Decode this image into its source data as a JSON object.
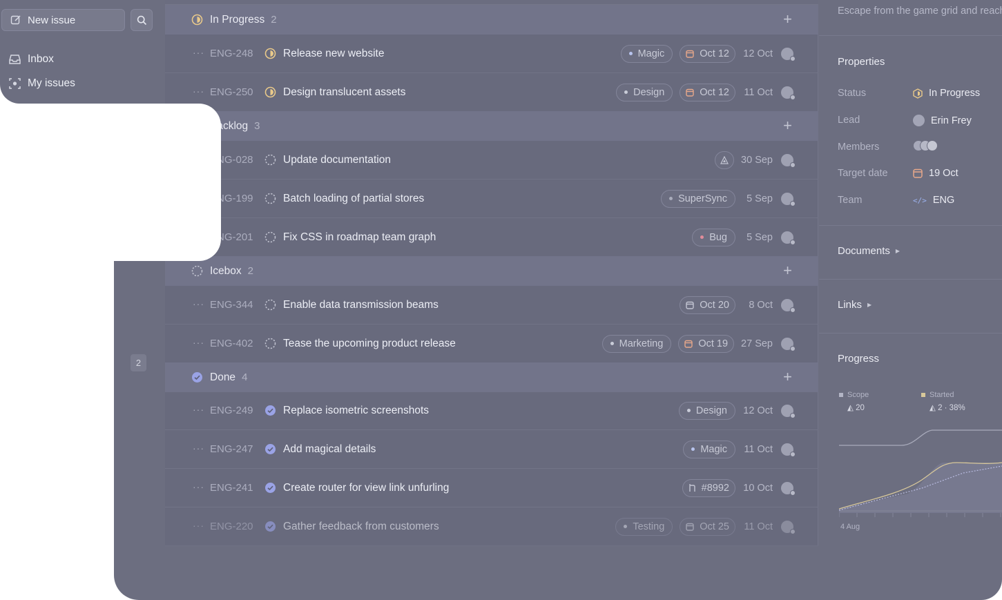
{
  "sidebar": {
    "new_issue_label": "New issue",
    "nav": [
      {
        "label": "Inbox"
      },
      {
        "label": "My issues"
      }
    ],
    "badge": "2"
  },
  "groups": [
    {
      "title": "In Progress",
      "count": "2"
    },
    {
      "title": "Backlog",
      "count": "3"
    },
    {
      "title": "Icebox",
      "count": "2"
    },
    {
      "title": "Done",
      "count": "4"
    }
  ],
  "issues": [
    {
      "id": "ENG-248",
      "title": "Release new website",
      "label": "Magic",
      "label_color": "#b8c4ee",
      "due": "Oct 12",
      "date": "12 Oct"
    },
    {
      "id": "ENG-250",
      "title": "Design translucent assets",
      "label": "Design",
      "label_color": "#c9ccd8",
      "due": "Oct 12",
      "date": "11 Oct"
    },
    {
      "id": "ENG-028",
      "title": "Update documentation",
      "date": "30 Sep"
    },
    {
      "id": "ENG-199",
      "title": "Batch loading of partial stores",
      "label": "SuperSync",
      "label_color": "#a9acbb",
      "date": "5 Sep"
    },
    {
      "id": "ENG-201",
      "title": "Fix CSS in roadmap team graph",
      "label": "Bug",
      "label_color": "#e08c9a",
      "date": "5 Sep"
    },
    {
      "id": "ENG-344",
      "title": "Enable data transmission beams",
      "due": "Oct 20",
      "date": "8 Oct"
    },
    {
      "id": "ENG-402",
      "title": "Tease the upcoming product release",
      "label": "Marketing",
      "label_color": "#c9ccd8",
      "due": "Oct 19",
      "date": "27 Sep"
    },
    {
      "id": "ENG-249",
      "title": "Replace isometric screenshots",
      "label": "Design",
      "label_color": "#c9ccd8",
      "date": "12 Oct"
    },
    {
      "id": "ENG-247",
      "title": "Add magical details",
      "label": "Magic",
      "label_color": "#b8c4ee",
      "date": "11 Oct"
    },
    {
      "id": "ENG-241",
      "title": "Create router for view link unfurling",
      "pr": "#8992",
      "date": "10 Oct"
    },
    {
      "id": "ENG-220",
      "title": "Gather feedback from customers",
      "label": "Testing",
      "label_color": "#c9ccd8",
      "due": "Oct 25",
      "date": "11 Oct"
    }
  ],
  "panel": {
    "description": "Escape from the game grid and reach",
    "properties_title": "Properties",
    "status_label": "Status",
    "status_value": "In Progress",
    "lead_label": "Lead",
    "lead_value": "Erin Frey",
    "members_label": "Members",
    "target_label": "Target date",
    "target_value": "19 Oct",
    "team_label": "Team",
    "team_value": "ENG",
    "documents_title": "Documents",
    "links_title": "Links",
    "progress_title": "Progress",
    "scope_label": "Scope",
    "scope_value": "20",
    "started_label": "Started",
    "started_value": "2 · 38%",
    "axis_start": "4 Aug"
  },
  "colors": {
    "in_progress": "#e9c98a",
    "done": "#9aa3e6",
    "calendar": "#e8a88a"
  }
}
